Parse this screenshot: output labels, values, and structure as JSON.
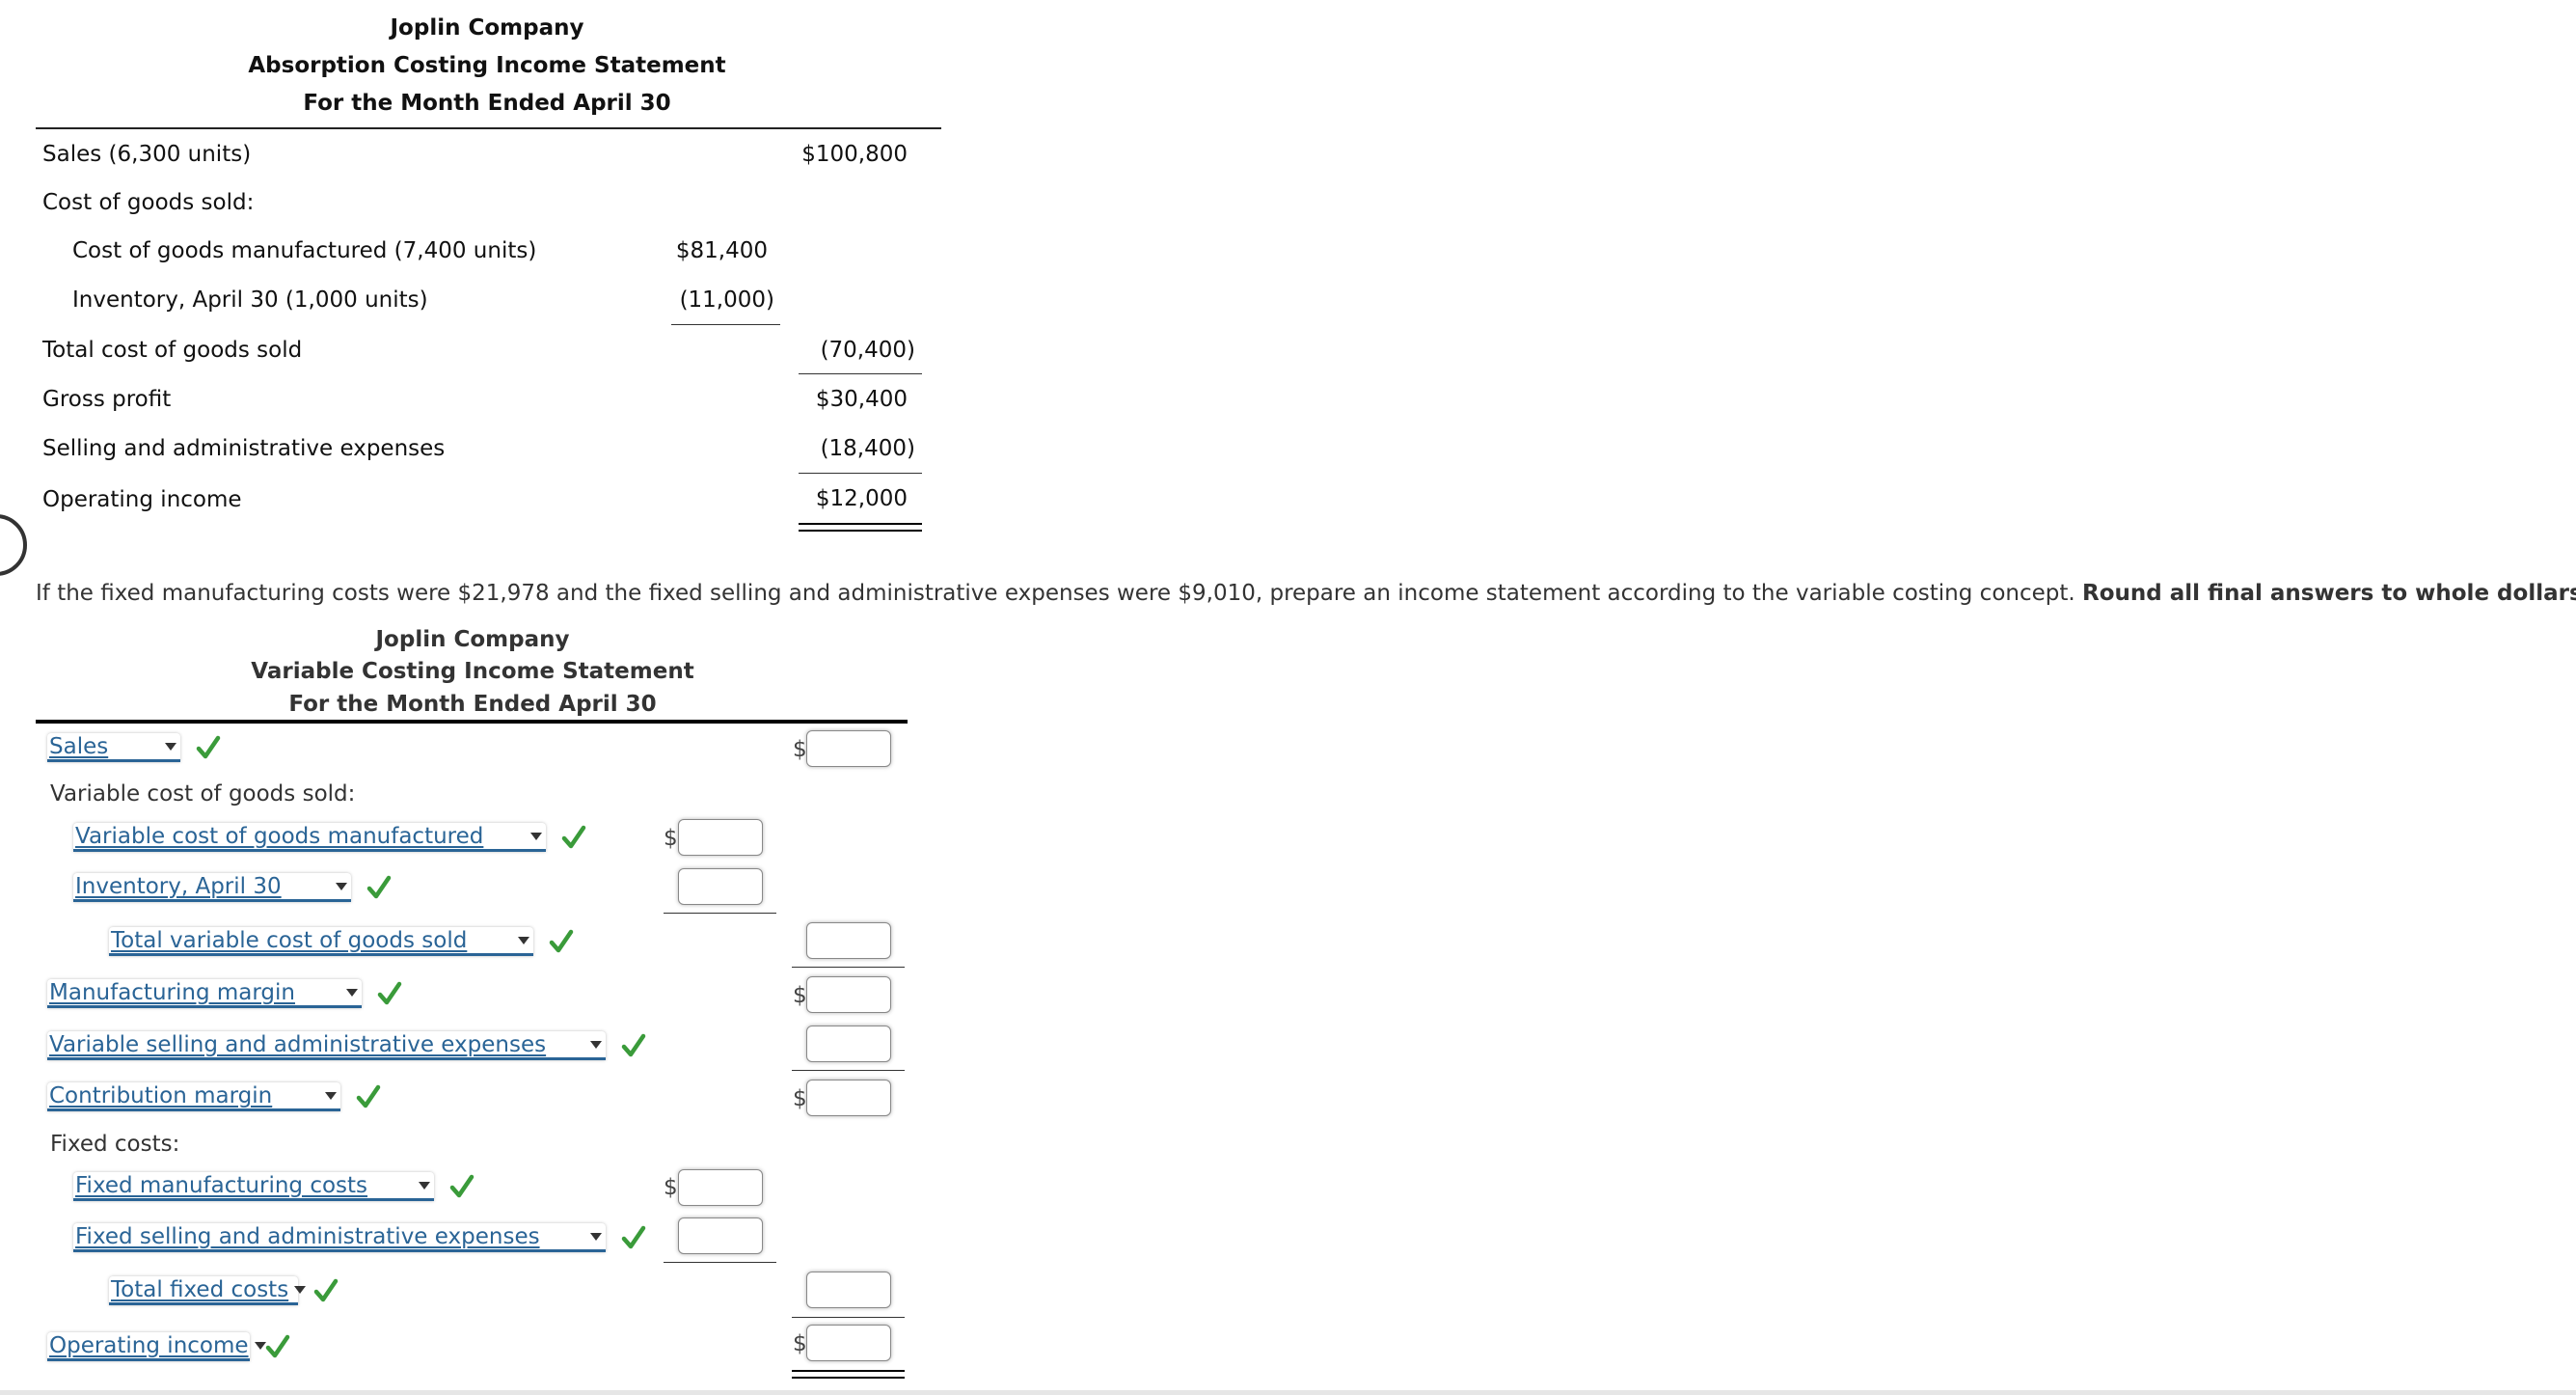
{
  "absorption": {
    "company": "Joplin Company",
    "statement_title": "Absorption Costing Income Statement",
    "period": "For the Month Ended April 30",
    "rows": [
      {
        "label": "Sales (6,300 units)",
        "mid": "",
        "right": "$100,800"
      },
      {
        "label": "Cost of goods sold:",
        "mid": "",
        "right": ""
      },
      {
        "label": "Cost of goods manufactured (7,400 units)",
        "mid": "$81,400",
        "right": ""
      },
      {
        "label": "Inventory, April 30 (1,000 units)",
        "mid": "(11,000)",
        "right": ""
      },
      {
        "label": "Total cost of goods sold",
        "mid": "",
        "right": "(70,400)"
      },
      {
        "label": "Gross profit",
        "mid": "",
        "right": "$30,400"
      },
      {
        "label": "Selling and administrative expenses",
        "mid": "",
        "right": "(18,400)"
      },
      {
        "label": "Operating income",
        "mid": "",
        "right": "$12,000"
      }
    ]
  },
  "instruction": {
    "text": "If the fixed manufacturing costs were $21,978 and the fixed selling and administrative expenses were $9,010, prepare an income statement according to the variable costing concept.",
    "bold": "Round all final answers to whole dollars."
  },
  "variable": {
    "company": "Joplin Company",
    "statement_title": "Variable Costing Income Statement",
    "period": "For the Month Ended April 30",
    "section_labels": {
      "variable_cogs": "Variable cost of goods sold:",
      "fixed_costs": "Fixed costs:"
    },
    "currency_symbol": "$",
    "dropdowns": [
      {
        "selected": "Sales",
        "status": "correct"
      },
      {
        "selected": "Variable cost of goods manufactured",
        "status": "correct"
      },
      {
        "selected": "Inventory, April 30",
        "status": "correct"
      },
      {
        "selected": "Total variable cost of goods sold",
        "status": "correct"
      },
      {
        "selected": "Manufacturing margin",
        "status": "correct"
      },
      {
        "selected": "Variable selling and administrative expenses",
        "status": "correct"
      },
      {
        "selected": "Contribution margin",
        "status": "correct"
      },
      {
        "selected": "Fixed manufacturing costs",
        "status": "correct"
      },
      {
        "selected": "Fixed selling and administrative expenses",
        "status": "correct"
      },
      {
        "selected": "Total fixed costs",
        "status": "correct"
      },
      {
        "selected": "Operating income",
        "status": "correct"
      }
    ],
    "inputs": {
      "sales": "",
      "variable_cogm": "",
      "inventory_april_30": "",
      "total_variable_cogs": "",
      "manufacturing_margin": "",
      "variable_selling_admin": "",
      "contribution_margin": "",
      "fixed_manufacturing": "",
      "fixed_selling_admin": "",
      "total_fixed_costs": "",
      "operating_income": ""
    }
  },
  "colors": {
    "dropdown_text": "#2a6496",
    "check_green": "#3a9b3a",
    "text": "#333333"
  }
}
